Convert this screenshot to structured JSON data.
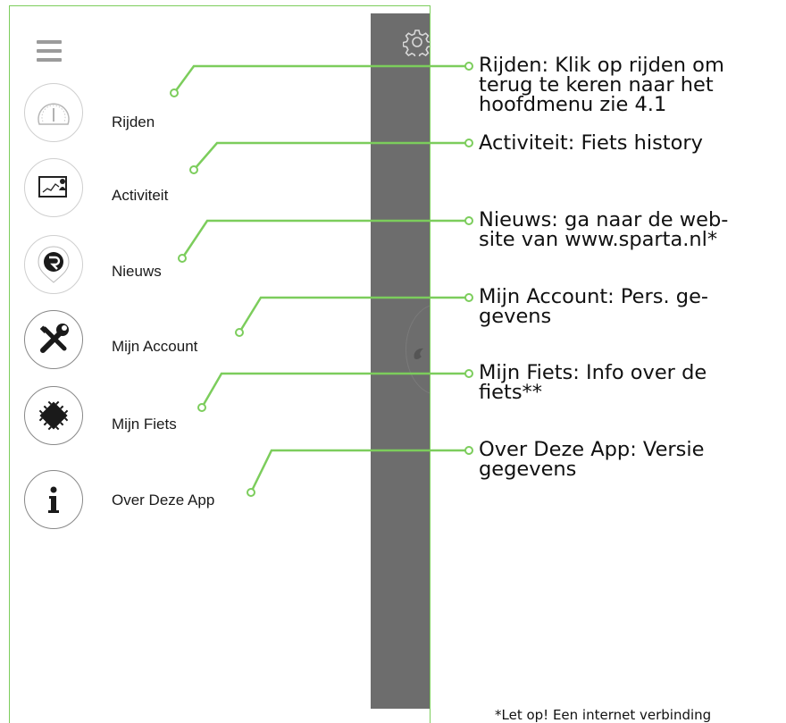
{
  "colors": {
    "accent": "#7ccd5c",
    "panel": "#6d6d6d",
    "icon_border": "#cfcfcf"
  },
  "menu_items": [
    {
      "key": "rijden",
      "label": "Rijden",
      "icon": "speedometer-icon"
    },
    {
      "key": "activiteit",
      "label": "Activiteit",
      "icon": "activity-chart-icon"
    },
    {
      "key": "nieuws",
      "label": "Nieuws",
      "icon": "news-logo-icon"
    },
    {
      "key": "mijn-account",
      "label": "Mijn Account",
      "icon": "tools-icon"
    },
    {
      "key": "mijn-fiets",
      "label": "Mijn Fiets",
      "icon": "chip-icon"
    },
    {
      "key": "over-deze-app",
      "label": "Over Deze App",
      "icon": "info-icon"
    }
  ],
  "callouts": [
    {
      "key": "rijden",
      "text": "Rijden: Klik op rijden om\nterug te keren naar het\nhoofdmenu zie 4.1"
    },
    {
      "key": "activiteit",
      "text": "Activiteit: Fiets history"
    },
    {
      "key": "nieuws",
      "text": "Nieuws: ga naar de web-\nsite van www.sparta.nl*"
    },
    {
      "key": "mijn-account",
      "text": "Mijn Account: Pers. ge-\ngevens"
    },
    {
      "key": "mijn-fiets",
      "text": "Mijn Fiets: Info over de\nfiets**"
    },
    {
      "key": "over-deze-app",
      "text": "Over Deze App: Versie\ngegevens"
    }
  ],
  "footnote": "*Let op! Een internet verbinding"
}
